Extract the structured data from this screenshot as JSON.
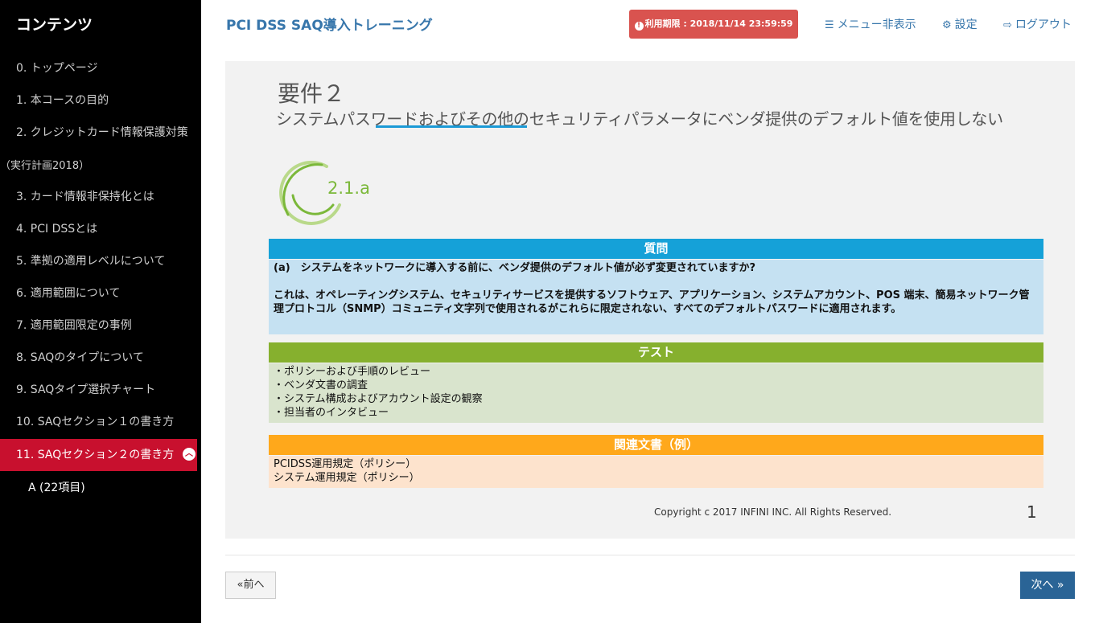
{
  "sidebar": {
    "title": "コンテンツ",
    "items": [
      {
        "label": "0. トップページ"
      },
      {
        "label": "1. 本コースの目的"
      },
      {
        "label": "2. クレジットカード情報保護対策"
      },
      {
        "label": "（実行計画2018）"
      },
      {
        "label": "3. カード情報非保持化とは"
      },
      {
        "label": "4. PCI DSSとは"
      },
      {
        "label": "5. 準拠の適用レベルについて"
      },
      {
        "label": "6. 適用範囲について"
      },
      {
        "label": "7. 適用範囲限定の事例"
      },
      {
        "label": "8. SAQのタイプについて"
      },
      {
        "label": "9. SAQタイプ選択チャート"
      },
      {
        "label": "10. SAQセクション１の書き方"
      },
      {
        "label": "11. SAQセクション２の書き方"
      }
    ],
    "sub_item": "A (22項目)"
  },
  "header": {
    "title": "PCI DSS SAQ導入トレーニング",
    "deadline": "利用期限 : 2018/11/14 23:59:59",
    "menu_toggle": "メニュー非表示",
    "settings": "設定",
    "logout": "ログアウト"
  },
  "slide": {
    "requirement": "要件２",
    "subtitle": "システムパスワードおよびその他のセキュリティパラメータにベンダ提供のデフォルト値を使用しない",
    "code": "2.1.a",
    "question": {
      "heading": "質問",
      "q": "(a)　システムをネットワークに導入する前に、ベンダ提供のデフォルト値が必ず変更されていますか?",
      "note": "これは、オペレーティングシステム、セキュリティサービスを提供するソフトウェア、アプリケーション、システムアカウント、POS 端末、簡易ネットワーク管理プロトコル（SNMP）コミュニティ文字列で使用されるがこれらに限定されない、すべてのデフォルトパスワードに適用されます。"
    },
    "test": {
      "heading": "テスト",
      "items": [
        "・ポリシーおよび手順のレビュー",
        "・ベンダ文書の調査",
        "・システム構成およびアカウント設定の観察",
        "・担当者のインタビュー"
      ]
    },
    "docs": {
      "heading": "関連文書（例）",
      "items": [
        "PCIDSS運用規定（ポリシー）",
        "システム運用規定（ポリシー）"
      ]
    },
    "copyright": "Copyright c 2017 INFINI INC. All Rights Reserved.",
    "page_number": "1"
  },
  "nav": {
    "prev": "«前へ",
    "next": "次へ »"
  },
  "colors": {
    "sidebar_bg": "#000000",
    "active_item": "#c8102e",
    "brand_blue": "#3776ab",
    "deadline_red": "#d9534f",
    "question_blue": "#15a1d8",
    "test_green": "#86b02e",
    "docs_orange": "#ffa81b",
    "next_button": "#2a6496"
  }
}
